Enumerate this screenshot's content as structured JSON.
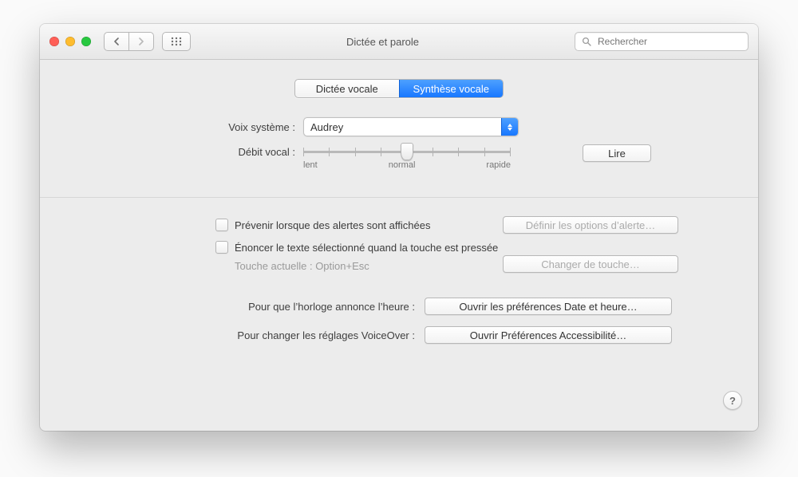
{
  "window": {
    "title": "Dictée et parole"
  },
  "toolbar": {
    "search_placeholder": "Rechercher"
  },
  "tabs": {
    "dictation": "Dictée vocale",
    "tts": "Synthèse vocale",
    "active": "tts"
  },
  "voice": {
    "label": "Voix système :",
    "selected": "Audrey"
  },
  "rate": {
    "label": "Débit vocal :",
    "tick_labels": {
      "slow": "lent",
      "normal": "normal",
      "fast": "rapide"
    },
    "value": 0.5
  },
  "play_button": "Lire",
  "alerts": {
    "checkbox_label": "Prévenir lorsque des alertes sont affichées",
    "options_button": "Définir les options d’alerte…"
  },
  "speak_sel": {
    "checkbox_label": "Énoncer le texte sélectionné quand la touche est pressée",
    "current_key_label": "Touche actuelle : ",
    "current_key_value": "Option+Esc",
    "change_key_button": "Changer de touche…"
  },
  "clock": {
    "label": "Pour que l’horloge annonce l’heure :",
    "button": "Ouvrir les préférences Date et heure…"
  },
  "voiceover": {
    "label": "Pour changer les réglages VoiceOver :",
    "button": "Ouvrir Préférences Accessibilité…"
  },
  "help": "?"
}
